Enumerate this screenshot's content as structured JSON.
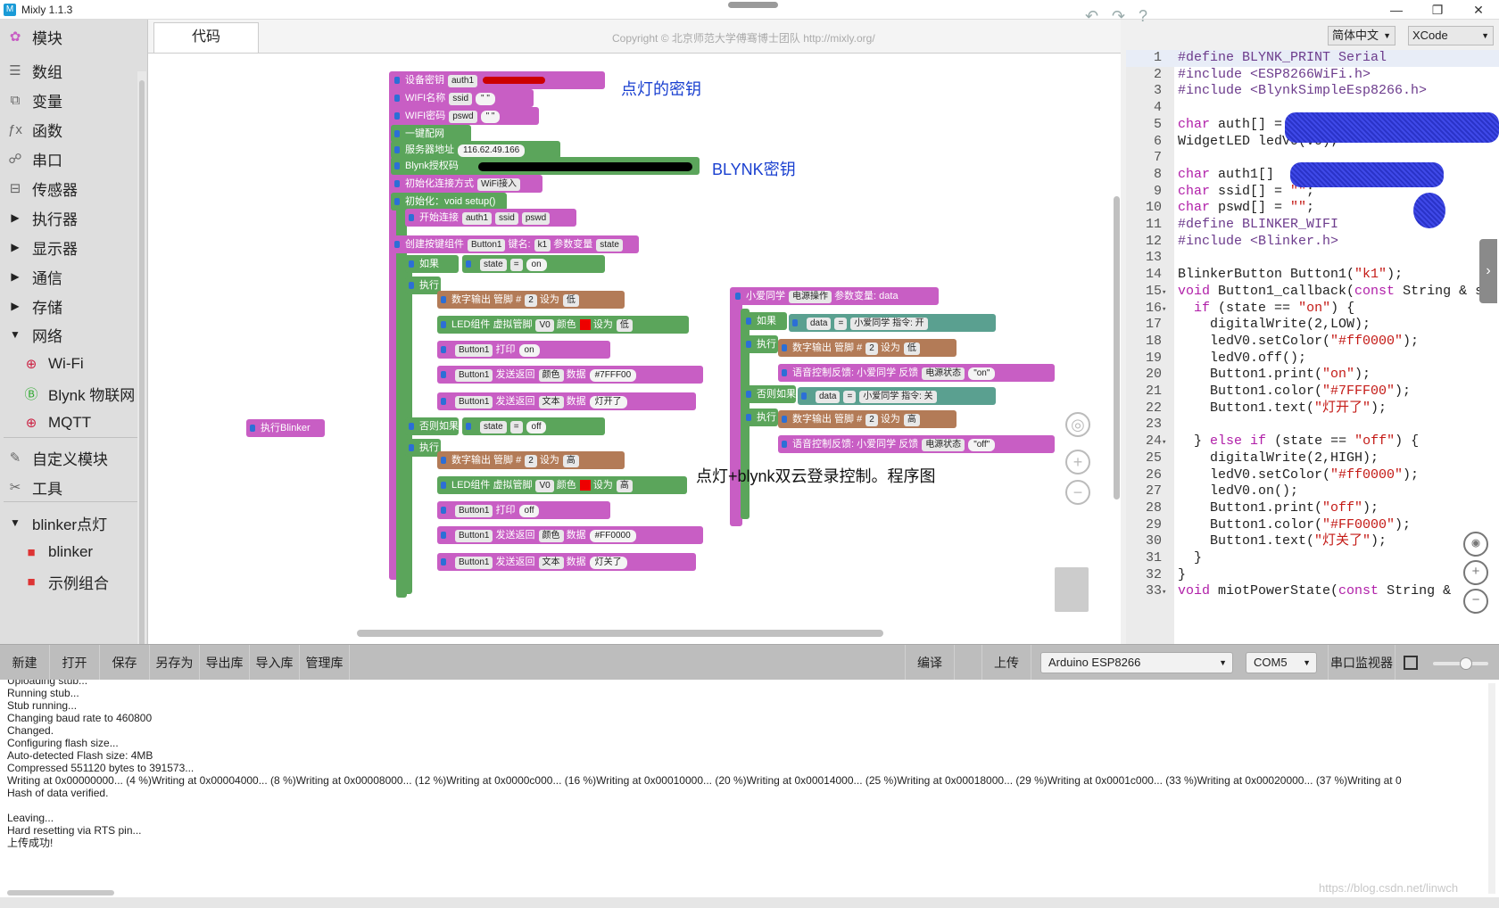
{
  "window": {
    "title": "Mixly 1.1.3",
    "min": "—",
    "max": "❐",
    "close": "✕"
  },
  "sidebar": {
    "items": [
      {
        "label": "模块",
        "icon": "blocks-icon"
      },
      {
        "label": "数组",
        "icon": "list-icon"
      },
      {
        "label": "变量",
        "icon": "variable-icon"
      },
      {
        "label": "函数",
        "icon": "function-icon"
      },
      {
        "label": "串口",
        "icon": "serial-icon"
      },
      {
        "label": "传感器",
        "icon": "sensor-icon"
      },
      {
        "label": "执行器",
        "icon": "expand-arrow-icon"
      },
      {
        "label": "显示器",
        "icon": "expand-arrow-icon"
      },
      {
        "label": "通信",
        "icon": "expand-arrow-icon"
      },
      {
        "label": "存储",
        "icon": "expand-arrow-icon"
      },
      {
        "label": "网络",
        "icon": "collapse-arrow-icon"
      },
      {
        "label": "Wi-Fi",
        "icon": "globe-icon"
      },
      {
        "label": "Blynk 物联网",
        "icon": "blynk-icon"
      },
      {
        "label": "MQTT",
        "icon": "globe-icon"
      },
      {
        "label": "自定义模块",
        "icon": "pen-icon"
      },
      {
        "label": "工具",
        "icon": "tools-icon"
      },
      {
        "label": "blinker点灯",
        "icon": "collapse-arrow-icon"
      },
      {
        "label": "blinker",
        "icon": "blinker-icon"
      },
      {
        "label": "示例组合",
        "icon": "blinker-icon"
      }
    ]
  },
  "tabs": {
    "code": "代码"
  },
  "header": {
    "copyright": "Copyright © 北京师范大学傅骞博士团队 http://mixly.org/",
    "language": "简体中文",
    "theme": "XCode"
  },
  "workspace": {
    "note_key": "点灯的密钥",
    "note_blynk": "BLYNK密钥",
    "note_program": "点灯+blynk双云登录控制。程序图",
    "blocks": {
      "device_key": "设备密钥",
      "auth1": "auth1",
      "wifi_name": "WIFI名称",
      "ssid": "ssid",
      "wifi_pwd": "WIFI密码",
      "pswd": "pswd",
      "one_key": "一键配网",
      "server_addr": "服务器地址",
      "server_ip": "116.62.49.166",
      "blynk_auth": "Blynk授权码",
      "init_conn": "初始化连接方式",
      "wifi_access": "WiFi接入",
      "init_setup": "初始化：void setup()",
      "start_conn": "开始连接",
      "create_btn": "创建按键组件",
      "button1": "Button1",
      "key_name": "键名:",
      "k1": "k1",
      "param_var": "参数变量",
      "state": "state",
      "if": "如果",
      "exec": "执行",
      "else_if": "否则如果",
      "eq": "=",
      "on": "on",
      "off": "off",
      "digital_out": "数字输出 管脚 #",
      "pin2": "2",
      "set_to": "设为",
      "low": "低",
      "high": "高",
      "led_comp": "LED组件 虚拟管脚",
      "v0": "V0",
      "color": "颜色",
      "print": "打印",
      "send_back": "发送返回",
      "color_field": "颜色",
      "text_field": "文本",
      "data": "数据",
      "color_on": "#7FFF00",
      "color_off": "#FF0000",
      "text_on": "灯开了",
      "text_off": "灯关了",
      "run_blinker": "执行Blinker",
      "xiaoai": "小爱同学",
      "power_op": "电源操作",
      "param_data": "参数变量: data",
      "data_var": "data",
      "xiaoai_cmd_on": "小爱同学  指令: 开",
      "xiaoai_cmd_off": "小爱同学  指令: 关",
      "voice_feedback": "语音控制反馈: 小爱同学",
      "feedback": "反馈",
      "power_state": "电源状态",
      "fb_on": "\"on\"",
      "fb_off": "\"off\""
    }
  },
  "code": {
    "lines": [
      {
        "n": "1",
        "t": "#define BLYNK_PRINT Serial"
      },
      {
        "n": "2",
        "t": "#include <ESP8266WiFi.h>"
      },
      {
        "n": "3",
        "t": "#include <BlynkSimpleEsp8266.h>"
      },
      {
        "n": "4",
        "t": ""
      },
      {
        "n": "5",
        "t": "char auth[] = "
      },
      {
        "n": "6",
        "t": "WidgetLED ledV0(V0);"
      },
      {
        "n": "7",
        "t": ""
      },
      {
        "n": "8",
        "t": "char auth1[] "
      },
      {
        "n": "9",
        "t": "char ssid[] = \"\";"
      },
      {
        "n": "10",
        "t": "char pswd[] = \"\";"
      },
      {
        "n": "11",
        "t": "#define BLINKER_WIFI"
      },
      {
        "n": "12",
        "t": "#include <Blinker.h>"
      },
      {
        "n": "13",
        "t": ""
      },
      {
        "n": "14",
        "t": "BlinkerButton Button1(\"k1\");"
      },
      {
        "n": "15",
        "t": "void Button1_callback(const String & s"
      },
      {
        "n": "16",
        "t": "  if (state == \"on\") {"
      },
      {
        "n": "17",
        "t": "    digitalWrite(2,LOW);"
      },
      {
        "n": "18",
        "t": "    ledV0.setColor(\"#ff0000\");"
      },
      {
        "n": "19",
        "t": "    ledV0.off();"
      },
      {
        "n": "20",
        "t": "    Button1.print(\"on\");"
      },
      {
        "n": "21",
        "t": "    Button1.color(\"#7FFF00\");"
      },
      {
        "n": "22",
        "t": "    Button1.text(\"灯开了\");"
      },
      {
        "n": "23",
        "t": ""
      },
      {
        "n": "24",
        "t": "  } else if (state == \"off\") {"
      },
      {
        "n": "25",
        "t": "    digitalWrite(2,HIGH);"
      },
      {
        "n": "26",
        "t": "    ledV0.setColor(\"#ff0000\");"
      },
      {
        "n": "27",
        "t": "    ledV0.on();"
      },
      {
        "n": "28",
        "t": "    Button1.print(\"off\");"
      },
      {
        "n": "29",
        "t": "    Button1.color(\"#FF0000\");"
      },
      {
        "n": "30",
        "t": "    Button1.text(\"灯关了\");"
      },
      {
        "n": "31",
        "t": "  }"
      },
      {
        "n": "32",
        "t": "}"
      },
      {
        "n": "33",
        "t": "void miotPowerState(const String &"
      }
    ]
  },
  "toolbar": {
    "new": "新建",
    "open": "打开",
    "save": "保存",
    "save_as": "另存为",
    "export_lib": "导出库",
    "import_lib": "导入库",
    "manage_lib": "管理库",
    "compile": "编译",
    "upload": "上传",
    "board": "Arduino ESP8266",
    "port": "COM5",
    "serial_monitor": "串口监视器"
  },
  "console": {
    "lines": [
      "Uploading stub...",
      "Running stub...",
      "Stub running...",
      "Changing baud rate to 460800",
      "Changed.",
      "Configuring flash size...",
      "Auto-detected Flash size: 4MB",
      "Compressed 551120 bytes to 391573...",
      "Writing at 0x00000000... (4 %)Writing at 0x00004000... (8 %)Writing at 0x00008000... (12 %)Writing at 0x0000c000... (16 %)Writing at 0x00010000... (20 %)Writing at 0x00014000... (25 %)Writing at 0x00018000... (29 %)Writing at 0x0001c000... (33 %)Writing at 0x00020000... (37 %)Writing at 0",
      "Hash of data verified.",
      "",
      "Leaving...",
      "Hard resetting via RTS pin...",
      "上传成功!"
    ],
    "watermark": "https://blog.csdn.net/linwch"
  }
}
